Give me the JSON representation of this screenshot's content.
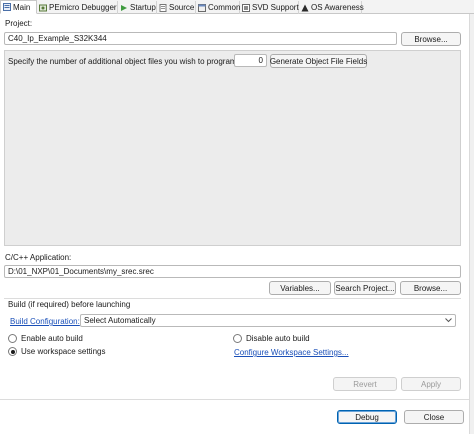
{
  "tabs": [
    {
      "label": "Main",
      "icon": "main-tab-icon",
      "active": true
    },
    {
      "label": "PEmicro Debugger",
      "icon": "debugger-icon"
    },
    {
      "label": "Startup",
      "icon": "startup-icon"
    },
    {
      "label": "Source",
      "icon": "source-icon"
    },
    {
      "label": "Common",
      "icon": "common-icon"
    },
    {
      "label": "SVD Support",
      "icon": "svd-icon"
    },
    {
      "label": "OS Awareness",
      "icon": "os-awareness-icon"
    }
  ],
  "project": {
    "label": "Project:",
    "value": "C40_Ip_Example_S32K344",
    "browse_label": "Browse..."
  },
  "object_files": {
    "label": "Specify the number of additional object files you wish to program:",
    "count": "0",
    "generate_label": "Generate Object File Fields"
  },
  "application": {
    "label": "C/C++ Application:",
    "value": "D:\\01_NXP\\01_Documents\\my_srec.srec",
    "variables_label": "Variables...",
    "search_label": "Search Project...",
    "browse_label": "Browse..."
  },
  "build": {
    "section_label": "Build (if required) before launching",
    "config_link": "Build Configuration:",
    "config_value": "Select Automatically",
    "enable_auto": "Enable auto build",
    "disable_auto": "Disable auto build",
    "use_workspace": "Use workspace settings",
    "configure_link": "Configure Workspace Settings...",
    "selected": "use_workspace"
  },
  "footer": {
    "revert_label": "Revert",
    "apply_label": "Apply",
    "debug_label": "Debug",
    "close_label": "Close"
  }
}
